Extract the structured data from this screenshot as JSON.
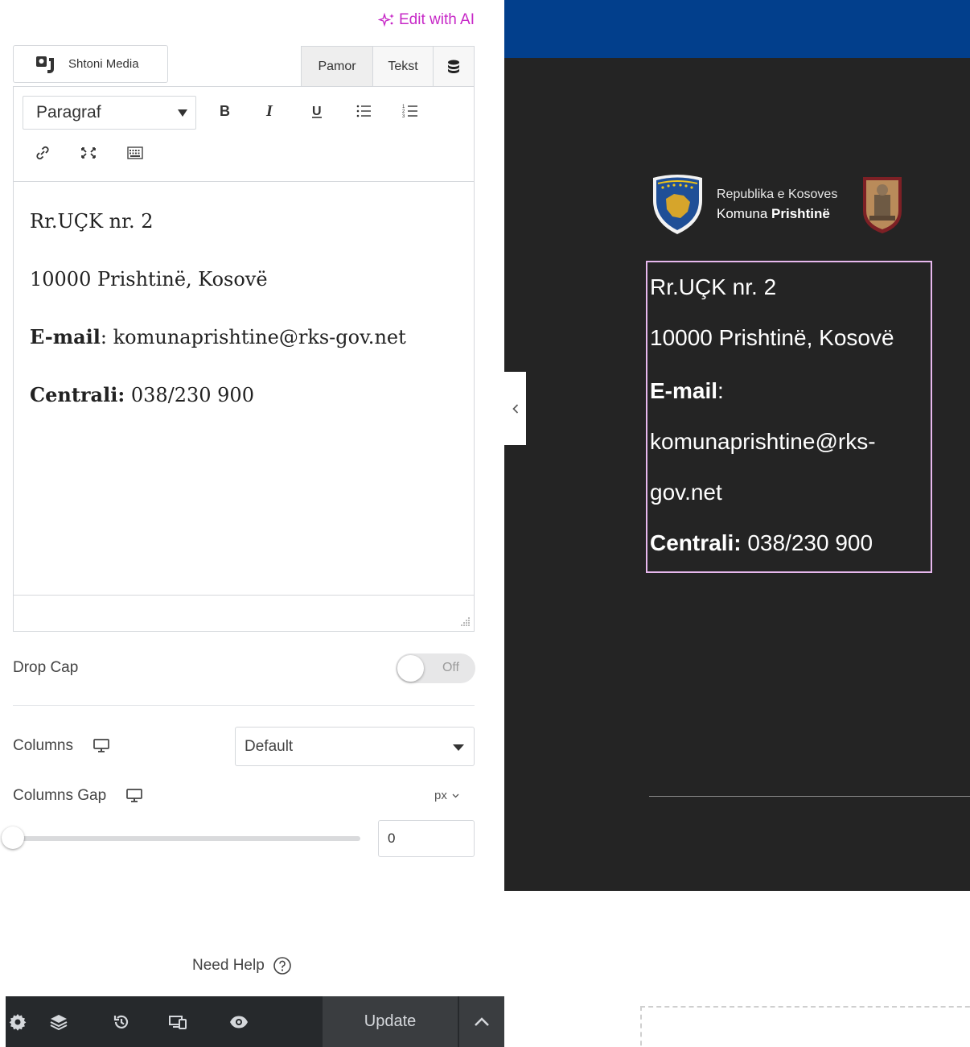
{
  "panel": {
    "ai_button": "Edit with AI",
    "add_media": "Shtoni Media",
    "tabs": {
      "visual": "Pamor",
      "text": "Tekst"
    },
    "format_select": "Paragraf",
    "editor_content": {
      "line1": "Rr.UÇK nr. 2",
      "line2": "10000 Prishtinë, Kosovë",
      "email_label": "E-mail",
      "email_value": ": komunaprishtine@rks-gov.net",
      "central_label": "Centrali:",
      "central_value": " 038/230 900"
    },
    "drop_cap": {
      "label": "Drop Cap",
      "state": "Off"
    },
    "columns": {
      "label": "Columns",
      "value": "Default"
    },
    "columns_gap": {
      "label": "Columns Gap",
      "unit": "px",
      "value": "0",
      "slider_fraction": 0
    },
    "help": "Need Help",
    "footer": {
      "update": "Update"
    }
  },
  "preview": {
    "brand": {
      "line1": "Republika e Kosoves",
      "line2_a": "Komuna ",
      "line2_b": "Prishtinë"
    },
    "address": {
      "line1": "Rr.UÇK nr. 2",
      "line2": "10000 Prishtinë, Kosovë",
      "email_label": "E-mail",
      "email_colon": ":",
      "email_part1": "komunaprishtine@rks-",
      "email_part2": "gov.net",
      "central_label": "Centrali:",
      "central_value": " 038/230 900"
    },
    "colors": {
      "topbar": "#023f8c",
      "background": "#242424",
      "selection": "#e7b8ee",
      "ai_accent": "#c729c7"
    }
  }
}
